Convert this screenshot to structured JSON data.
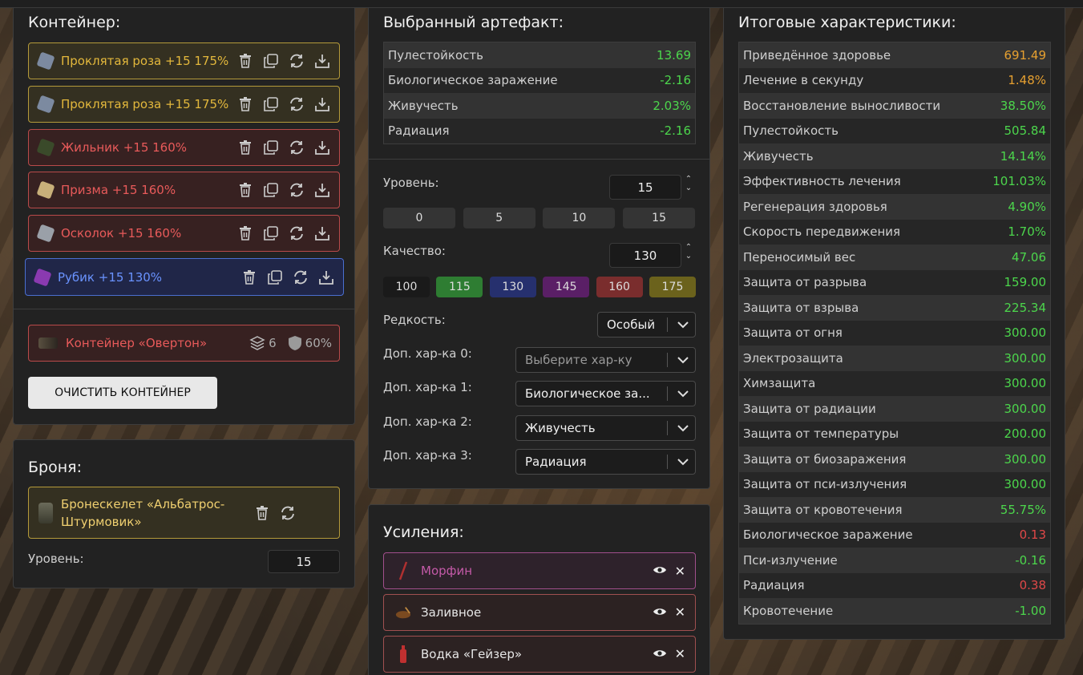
{
  "container": {
    "title": "Контейнер:",
    "artifacts": [
      {
        "name": "Проклятая роза +15 175%",
        "color": "gold"
      },
      {
        "name": "Проклятая роза +15 175%",
        "color": "gold"
      },
      {
        "name": "Жильник +15 160%",
        "color": "red"
      },
      {
        "name": "Призма +15 160%",
        "color": "red"
      },
      {
        "name": "Осколок +15 160%",
        "color": "red"
      },
      {
        "name": "Рубик +15 130%",
        "color": "blue"
      }
    ],
    "container_item": {
      "name": "Контейнер «Овертон»",
      "slots": "6",
      "protection": "60%"
    },
    "clear_button": "ОЧИСТИТЬ КОНТЕЙНЕР"
  },
  "armor": {
    "title": "Броня:",
    "item_name": "Бронескелет «Альбатрос-Штурмовик»",
    "level_label": "Уровень:",
    "level_value": "15"
  },
  "selected": {
    "title": "Выбранный артефакт:",
    "stats": [
      {
        "name": "Пулестойкость",
        "value": "13.69"
      },
      {
        "name": "Биологическое заражение",
        "value": "-2.16"
      },
      {
        "name": "Живучесть",
        "value": "2.03%"
      },
      {
        "name": "Радиация",
        "value": "-2.16"
      }
    ],
    "level_label": "Уровень:",
    "level_value": "15",
    "level_presets": [
      "0",
      "5",
      "10",
      "15"
    ],
    "quality_label": "Качество:",
    "quality_value": "130",
    "quality_presets": [
      {
        "label": "100",
        "color": "#1a1a1a"
      },
      {
        "label": "115",
        "color": "#2e7d32"
      },
      {
        "label": "130",
        "color": "#26306e"
      },
      {
        "label": "145",
        "color": "#5a1f66"
      },
      {
        "label": "160",
        "color": "#7a2d2d"
      },
      {
        "label": "175",
        "color": "#6b621c"
      }
    ],
    "rarity_label": "Редкость:",
    "rarity_value": "Особый",
    "extra": [
      {
        "label": "Доп. хар-ка 0:",
        "value": "Выберите хар-ку",
        "placeholder": true
      },
      {
        "label": "Доп. хар-ка 1:",
        "value": "Биологическое за...",
        "placeholder": false
      },
      {
        "label": "Доп. хар-ка 2:",
        "value": "Живучесть",
        "placeholder": false
      },
      {
        "label": "Доп. хар-ка 3:",
        "value": "Радиация",
        "placeholder": false
      }
    ]
  },
  "boosts": {
    "title": "Усиления:",
    "items": [
      {
        "name": "Морфин",
        "color": "#c45aa8",
        "border": "#a14f8c"
      },
      {
        "name": "Заливное",
        "color": "#e6e6e6",
        "border": "#a05050"
      },
      {
        "name": "Водка «Гейзер»",
        "color": "#e6e6e6",
        "border": "#a05050"
      }
    ]
  },
  "totals": {
    "title": "Итоговые характеристики:",
    "stats": [
      {
        "name": "Приведённое здоровье",
        "value": "691.49",
        "tone": "orange"
      },
      {
        "name": "Лечение в секунду",
        "value": "1.48%",
        "tone": "orange"
      },
      {
        "name": "Восстановление выносливости",
        "value": "38.50%",
        "tone": "green"
      },
      {
        "name": "Пулестойкость",
        "value": "505.84",
        "tone": "green"
      },
      {
        "name": "Живучесть",
        "value": "14.14%",
        "tone": "green"
      },
      {
        "name": "Эффективность лечения",
        "value": "101.03%",
        "tone": "green"
      },
      {
        "name": "Регенерация здоровья",
        "value": "4.90%",
        "tone": "green"
      },
      {
        "name": "Скорость передвижения",
        "value": "1.70%",
        "tone": "green"
      },
      {
        "name": "Переносимый вес",
        "value": "47.06",
        "tone": "green"
      },
      {
        "name": "Защита от разрыва",
        "value": "159.00",
        "tone": "green"
      },
      {
        "name": "Защита от взрыва",
        "value": "225.34",
        "tone": "green"
      },
      {
        "name": "Защита от огня",
        "value": "300.00",
        "tone": "green"
      },
      {
        "name": "Электрозащита",
        "value": "300.00",
        "tone": "green"
      },
      {
        "name": "Химзащита",
        "value": "300.00",
        "tone": "green"
      },
      {
        "name": "Защита от радиации",
        "value": "300.00",
        "tone": "green"
      },
      {
        "name": "Защита от температуры",
        "value": "200.00",
        "tone": "green"
      },
      {
        "name": "Защита от биозаражения",
        "value": "300.00",
        "tone": "green"
      },
      {
        "name": "Защита от пси-излучения",
        "value": "300.00",
        "tone": "green"
      },
      {
        "name": "Защита от кровотечения",
        "value": "55.75%",
        "tone": "green"
      },
      {
        "name": "Биологическое заражение",
        "value": "0.13",
        "tone": "red"
      },
      {
        "name": "Пси-излучение",
        "value": "-0.16",
        "tone": "green"
      },
      {
        "name": "Радиация",
        "value": "0.38",
        "tone": "red"
      },
      {
        "name": "Кровотечение",
        "value": "-1.00",
        "tone": "green"
      }
    ]
  }
}
